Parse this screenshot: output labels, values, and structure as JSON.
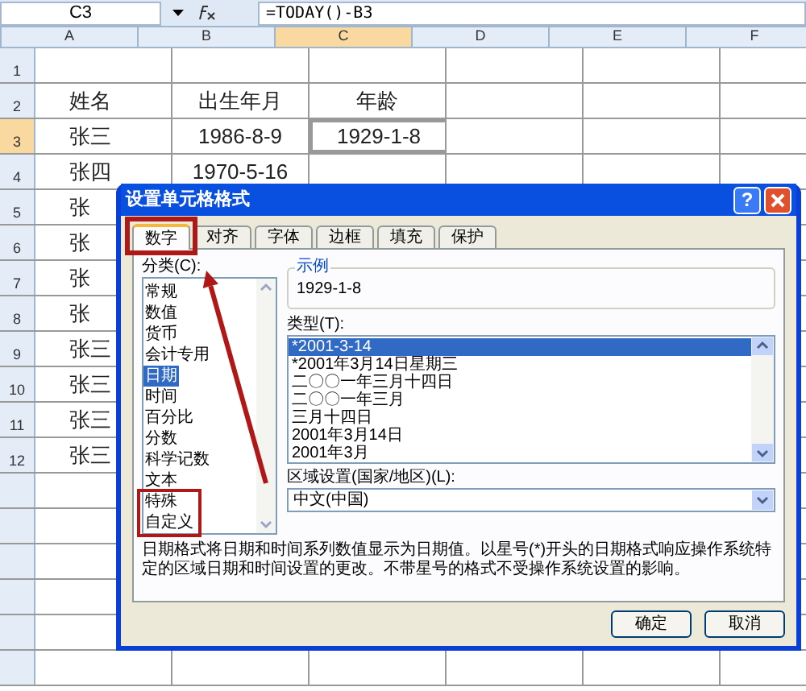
{
  "name_box": "C3",
  "formula": "=TODAY()-B3",
  "columns": [
    {
      "label": "A",
      "selected": false
    },
    {
      "label": "B",
      "selected": false
    },
    {
      "label": "C",
      "selected": true
    },
    {
      "label": "D",
      "selected": false
    },
    {
      "label": "E",
      "selected": false
    },
    {
      "label": "F",
      "selected": false
    }
  ],
  "rows": [
    {
      "label": "1",
      "selected": false,
      "cells": {}
    },
    {
      "label": "2",
      "selected": false,
      "cells": {
        "A": "姓名",
        "B": "出生年月",
        "C": "年龄"
      }
    },
    {
      "label": "3",
      "selected": true,
      "cells": {
        "A": "张三",
        "B": "1986-8-9",
        "C": "1929-1-8"
      }
    },
    {
      "label": "4",
      "selected": false,
      "cells": {
        "A": "张四",
        "B": "1970-5-16"
      }
    },
    {
      "label": "5",
      "selected": false,
      "cells": {
        "A": "张"
      }
    },
    {
      "label": "6",
      "selected": false,
      "cells": {
        "A": "张"
      }
    },
    {
      "label": "7",
      "selected": false,
      "cells": {
        "A": "张"
      }
    },
    {
      "label": "8",
      "selected": false,
      "cells": {
        "A": "张"
      }
    },
    {
      "label": "9",
      "selected": false,
      "cells": {
        "A": "张三"
      }
    },
    {
      "label": "10",
      "selected": false,
      "cells": {
        "A": "张三"
      }
    },
    {
      "label": "11",
      "selected": false,
      "cells": {
        "A": "张三"
      }
    },
    {
      "label": "12",
      "selected": false,
      "cells": {
        "A": "张三"
      }
    }
  ],
  "dialog": {
    "title": "设置单元格格式",
    "help": "?",
    "tabs": [
      {
        "label": "数字",
        "selected": true
      },
      {
        "label": "对齐",
        "selected": false
      },
      {
        "label": "字体",
        "selected": false
      },
      {
        "label": "边框",
        "selected": false
      },
      {
        "label": "填充",
        "selected": false
      },
      {
        "label": "保护",
        "selected": false
      }
    ],
    "category_label": "分类(C):",
    "categories": [
      {
        "label": "常规",
        "selected": false
      },
      {
        "label": "数值",
        "selected": false
      },
      {
        "label": "货币",
        "selected": false
      },
      {
        "label": "会计专用",
        "selected": false
      },
      {
        "label": "日期",
        "selected": true
      },
      {
        "label": "时间",
        "selected": false
      },
      {
        "label": "百分比",
        "selected": false
      },
      {
        "label": "分数",
        "selected": false
      },
      {
        "label": "科学记数",
        "selected": false
      },
      {
        "label": "文本",
        "selected": false
      },
      {
        "label": "特殊",
        "selected": false
      },
      {
        "label": "自定义",
        "selected": false
      }
    ],
    "sample_label": "示例",
    "sample_value": "1929-1-8",
    "type_label": "类型(T):",
    "types": [
      {
        "label": "*2001-3-14",
        "selected": true
      },
      {
        "label": "*2001年3月14日星期三",
        "selected": false
      },
      {
        "label": "二〇〇一年三月十四日",
        "selected": false
      },
      {
        "label": "二〇〇一年三月",
        "selected": false
      },
      {
        "label": "三月十四日",
        "selected": false
      },
      {
        "label": "2001年3月14日",
        "selected": false
      },
      {
        "label": "2001年3月",
        "selected": false
      }
    ],
    "locale_label": "区域设置(国家/地区)(L):",
    "locale_value": "中文(中国)",
    "description": "日期格式将日期和时间系列数值显示为日期值。以星号(*)开头的日期格式响应操作系统特定的区域日期和时间设置的更改。不带星号的格式不受操作系统设置的影响。",
    "buttons": [
      "确定",
      "取消"
    ]
  }
}
